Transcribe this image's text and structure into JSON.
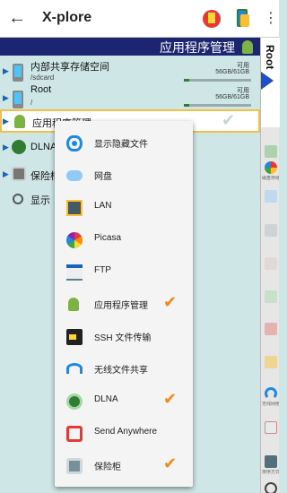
{
  "appbar": {
    "title": "X-plore",
    "back_icon": "arrow-left-icon"
  },
  "pane": {
    "header_title": "应用程序管理",
    "rows": [
      {
        "name": "内部共享存储空间",
        "path": "/sdcard",
        "free_label": "可用",
        "size": "56GB/61GB",
        "usage_fraction": 0.08
      },
      {
        "name": "Root",
        "path": "/",
        "free_label": "可用",
        "size": "56GB/61GB",
        "usage_fraction": 0.08
      },
      {
        "name": "应用程序管理"
      },
      {
        "name": "DLNA"
      },
      {
        "name": "保险柜"
      },
      {
        "name": "显示"
      }
    ]
  },
  "sidebar": {
    "tab_label": "Root",
    "buttons": [
      {
        "label": "",
        "icon": "copy-icon"
      },
      {
        "label": "磁盘存储区域",
        "icon": "disk-map-icon"
      },
      {
        "label": "",
        "icon": "rename-icon"
      },
      {
        "label": "",
        "icon": "duplicate-icon"
      },
      {
        "label": "",
        "icon": "clipboard-icon"
      },
      {
        "label": "",
        "icon": "zip-icon"
      },
      {
        "label": "",
        "icon": "delete-icon"
      },
      {
        "label": "",
        "icon": "new-folder-icon"
      },
      {
        "label": "无线网络服务器",
        "icon": "wifi-icon"
      },
      {
        "label": "",
        "icon": "new-file-icon"
      },
      {
        "label": "排序方式",
        "icon": "sort-icon"
      }
    ]
  },
  "menu": {
    "items": [
      {
        "label": "显示隐藏文件",
        "icon": "eye-icon",
        "checked": false
      },
      {
        "label": "网盘",
        "icon": "cloud-icon",
        "checked": false
      },
      {
        "label": "LAN",
        "icon": "lan-icon",
        "checked": false
      },
      {
        "label": "Picasa",
        "icon": "picasa-icon",
        "checked": false
      },
      {
        "label": "FTP",
        "icon": "ftp-icon",
        "checked": false
      },
      {
        "label": "应用程序管理",
        "icon": "android-icon",
        "checked": true
      },
      {
        "label": "SSH 文件传输",
        "icon": "ssh-terminal-icon",
        "checked": false
      },
      {
        "label": "无线文件共享",
        "icon": "wifi-share-icon",
        "checked": false
      },
      {
        "label": "DLNA",
        "icon": "dlna-icon",
        "checked": true
      },
      {
        "label": "Send Anywhere",
        "icon": "send-anywhere-icon",
        "checked": false
      },
      {
        "label": "保险柜",
        "icon": "vault-icon",
        "checked": true
      }
    ]
  },
  "colors": {
    "accent": "#1c2570",
    "check": "#f08a1c",
    "pane_bg": "#cfe6e6"
  }
}
